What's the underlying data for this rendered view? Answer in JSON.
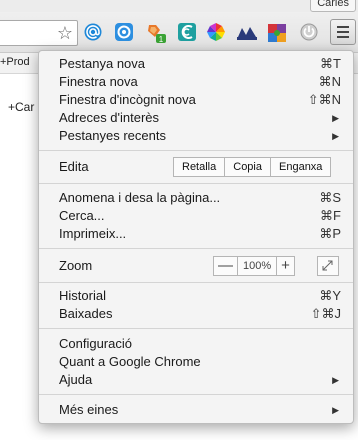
{
  "profile": {
    "name": "Carles"
  },
  "bookmarks_bar": {
    "item_label": "+Prod"
  },
  "page": {
    "content_text": "+Car"
  },
  "extensions": [
    {
      "icon": "at-sign-icon",
      "color": "#1e88d8"
    },
    {
      "icon": "target-icon",
      "color": "#2d8fe0"
    },
    {
      "icon": "pen-tool-icon",
      "color": "#e8782a",
      "badge": "1"
    },
    {
      "icon": "swirl-icon",
      "color": "#1fa0a0"
    },
    {
      "icon": "color-wheel-icon",
      "color": "#e33"
    },
    {
      "icon": "chart-icon",
      "color": "#2a3a7a"
    },
    {
      "icon": "puzzle-icon",
      "color": "#d4343a"
    },
    {
      "icon": "power-icon",
      "color": "#9a9a9a"
    }
  ],
  "menu": {
    "new_tab": {
      "label": "Pestanya nova",
      "shortcut": "⌘T"
    },
    "new_window": {
      "label": "Finestra nova",
      "shortcut": "⌘N"
    },
    "incognito": {
      "label": "Finestra d'incògnit nova",
      "shortcut": "⇧⌘N"
    },
    "bookmarks": {
      "label": "Adreces d'interès"
    },
    "recent_tabs": {
      "label": "Pestanyes recents"
    },
    "edit": {
      "label": "Edita",
      "cut": "Retalla",
      "copy": "Copia",
      "paste": "Enganxa"
    },
    "save_page": {
      "label": "Anomena i desa la pàgina...",
      "shortcut": "⌘S"
    },
    "find": {
      "label": "Cerca...",
      "shortcut": "⌘F"
    },
    "print": {
      "label": "Imprimeix...",
      "shortcut": "⌘P"
    },
    "zoom": {
      "label": "Zoom",
      "minus": "—",
      "level": "100%",
      "plus": "+"
    },
    "history": {
      "label": "Historial",
      "shortcut": "⌘Y"
    },
    "downloads": {
      "label": "Baixades",
      "shortcut": "⇧⌘J"
    },
    "settings": {
      "label": "Configuració"
    },
    "about": {
      "label": "Quant a Google Chrome"
    },
    "help": {
      "label": "Ajuda"
    },
    "more_tools": {
      "label": "Més eines"
    }
  }
}
